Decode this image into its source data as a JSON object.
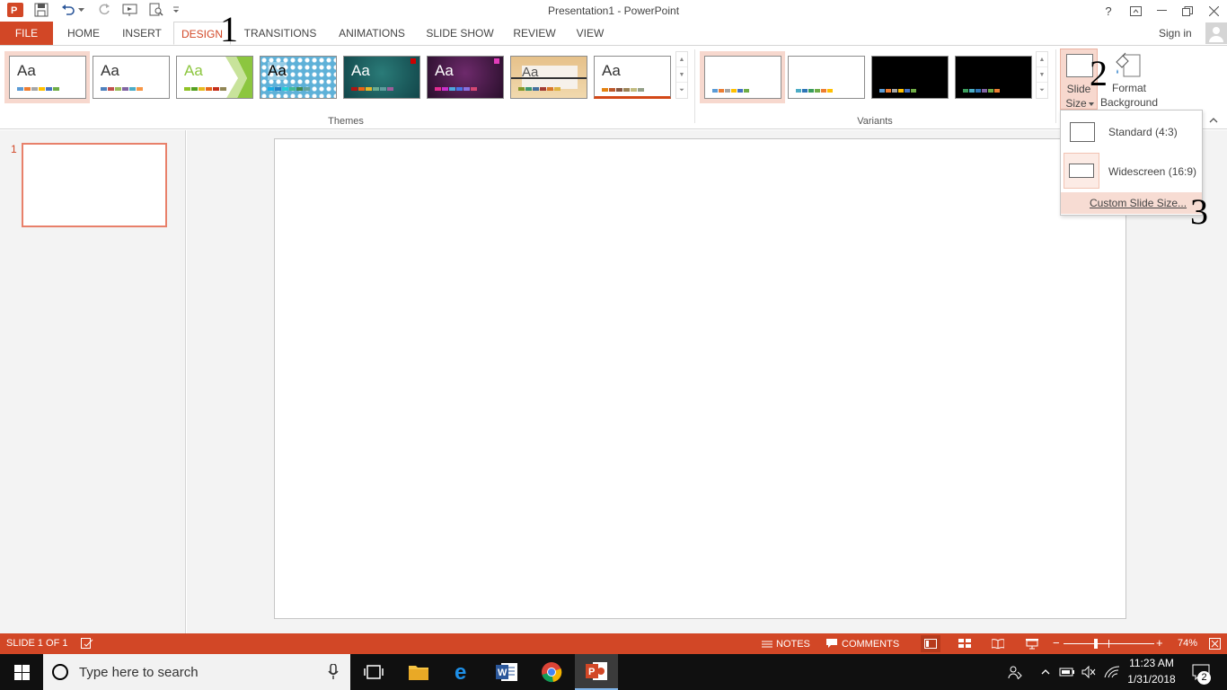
{
  "window": {
    "title": "Presentation1 - PowerPoint",
    "help": "?",
    "sign_in": "Sign in"
  },
  "tabs": [
    "FILE",
    "HOME",
    "INSERT",
    "DESIGN",
    "TRANSITIONS",
    "ANIMATIONS",
    "SLIDE SHOW",
    "REVIEW",
    "VIEW"
  ],
  "ribbon": {
    "themes_label": "Themes",
    "variants_label": "Variants",
    "theme_sample": "Aa",
    "slide_size_line1": "Slide",
    "slide_size_line2": "Size",
    "format_bg_line1": "Format",
    "format_bg_line2": "Background"
  },
  "dropdown": {
    "standard": "Standard (4:3)",
    "widescreen": "Widescreen (16:9)",
    "custom": "Custom Slide Size..."
  },
  "annotations": {
    "one": "1",
    "two": "2",
    "three": "3"
  },
  "thumbnail": {
    "number": "1"
  },
  "status": {
    "slide_info": "SLIDE 1 OF 1",
    "notes": "NOTES",
    "comments": "COMMENTS",
    "zoom_minus": "−",
    "zoom_plus": "+",
    "zoom": "74%"
  },
  "taskbar": {
    "search_placeholder": "Type here to search",
    "time": "11:23 AM",
    "date": "1/31/2018",
    "notif_count": "2"
  },
  "colors": {
    "accent": "#d24726",
    "accent_light": "#f7d8ce",
    "taskbar": "#101010"
  }
}
